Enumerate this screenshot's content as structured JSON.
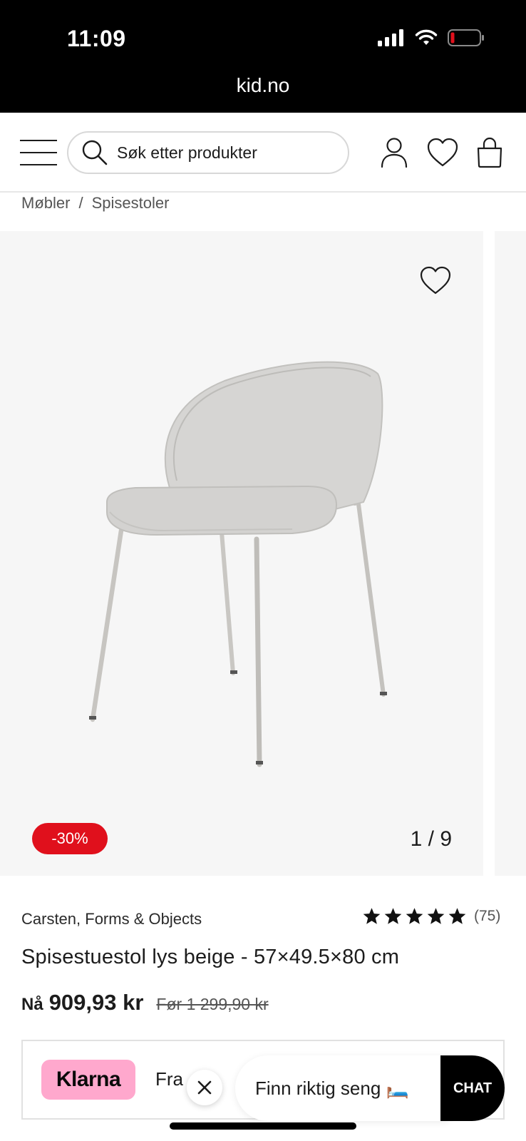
{
  "status_bar": {
    "time": "11:09",
    "url": "kid.no"
  },
  "header": {
    "search_placeholder": "Søk etter produkter",
    "icons": [
      "menu-icon",
      "search-icon",
      "user-icon",
      "heart-icon",
      "bag-icon"
    ]
  },
  "breadcrumb": {
    "items": [
      "Møbler",
      "Spisestoler"
    ],
    "separator": "/"
  },
  "gallery": {
    "discount_badge": "-30%",
    "counter": "1 / 9"
  },
  "product": {
    "brand": "Carsten, Forms & Objects",
    "rating_stars": 5,
    "reviews": "(75)",
    "title": "Spisestuestol lys beige - 57×49.5×80 cm",
    "price_now_label": "Nå",
    "price_now": "909,93 kr",
    "price_before": "Før 1 299,90 kr"
  },
  "klarna": {
    "logo": "Klarna",
    "text": "Fra"
  },
  "widget": {
    "finn_text": "Finn riktig seng 🛏️",
    "chat_label": "CHAT"
  },
  "colors": {
    "accent_red": "#e0101c",
    "klarna_pink": "#ffa8cd",
    "gallery_bg": "#f6f6f6"
  }
}
